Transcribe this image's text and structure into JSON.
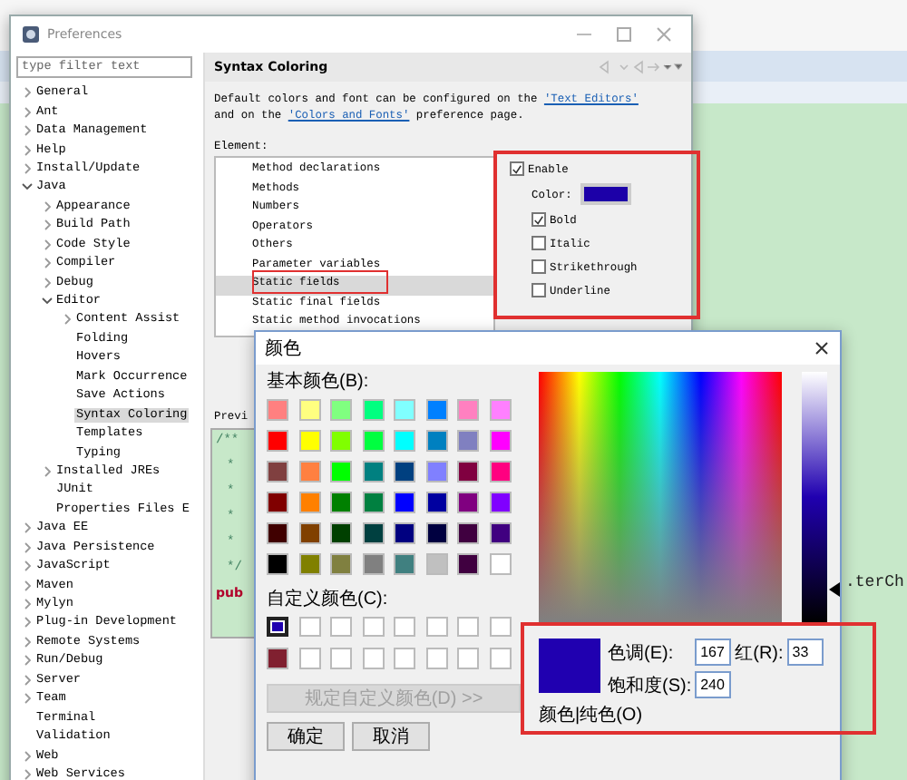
{
  "editor": {
    "fragment": ".terCh"
  },
  "preferences": {
    "title": "Preferences",
    "filter": {
      "placeholder": "type filter text"
    },
    "tree": [
      {
        "label": "General",
        "expanded": false,
        "selected": false
      },
      {
        "label": "Ant",
        "expanded": false,
        "selected": false
      },
      {
        "label": "Data Management",
        "expanded": false,
        "selected": false
      },
      {
        "label": "Help",
        "expanded": false,
        "selected": false
      },
      {
        "label": "Install/Update",
        "expanded": false,
        "selected": false
      },
      {
        "label": "Java",
        "expanded": true,
        "selected": false,
        "children": [
          {
            "label": "Appearance",
            "expanded": false,
            "selected": false
          },
          {
            "label": "Build Path",
            "expanded": false,
            "selected": false
          },
          {
            "label": "Code Style",
            "expanded": false,
            "selected": false
          },
          {
            "label": "Compiler",
            "expanded": false,
            "selected": false
          },
          {
            "label": "Debug",
            "expanded": false,
            "selected": false
          },
          {
            "label": "Editor",
            "expanded": true,
            "selected": false,
            "children": [
              {
                "label": "Content Assist",
                "expanded": false,
                "selected": false
              },
              {
                "label": "Folding",
                "selected": false
              },
              {
                "label": "Hovers",
                "selected": false
              },
              {
                "label": "Mark Occurrence",
                "selected": false
              },
              {
                "label": "Save Actions",
                "selected": false
              },
              {
                "label": "Syntax Coloring",
                "selected": true
              },
              {
                "label": "Templates",
                "selected": false
              },
              {
                "label": "Typing",
                "selected": false
              }
            ]
          },
          {
            "label": "Installed JREs",
            "expanded": false,
            "selected": false
          },
          {
            "label": "JUnit",
            "selected": false
          },
          {
            "label": "Properties Files E",
            "selected": false
          }
        ]
      },
      {
        "label": "Java EE",
        "expanded": false,
        "selected": false
      },
      {
        "label": "Java Persistence",
        "expanded": false,
        "selected": false
      },
      {
        "label": "JavaScript",
        "expanded": false,
        "selected": false
      },
      {
        "label": "Maven",
        "expanded": false,
        "selected": false
      },
      {
        "label": "Mylyn",
        "expanded": false,
        "selected": false
      },
      {
        "label": "Plug-in Development",
        "expanded": false,
        "selected": false
      },
      {
        "label": "Remote Systems",
        "expanded": false,
        "selected": false
      },
      {
        "label": "Run/Debug",
        "expanded": false,
        "selected": false
      },
      {
        "label": "Server",
        "expanded": false,
        "selected": false
      },
      {
        "label": "Team",
        "expanded": false,
        "selected": false
      },
      {
        "label": "Terminal",
        "selected": false
      },
      {
        "label": "Validation",
        "selected": false
      },
      {
        "label": "Web",
        "expanded": false,
        "selected": false
      },
      {
        "label": "Web Services",
        "expanded": false,
        "selected": false
      }
    ],
    "page": {
      "title": "Syntax Coloring",
      "description": [
        [
          {
            "text": "Default colors and font can be configured on the "
          },
          {
            "text": "'Text Editors'",
            "link": true
          }
        ],
        [
          {
            "text": "and on the "
          },
          {
            "text": "'Colors and Fonts'",
            "link": true
          },
          {
            "text": " preference page."
          }
        ]
      ],
      "element_label": "Element:",
      "elements": [
        {
          "label": "Method declarations",
          "selected": false
        },
        {
          "label": "Methods",
          "selected": false
        },
        {
          "label": "Numbers",
          "selected": false
        },
        {
          "label": "Operators",
          "selected": false
        },
        {
          "label": "Others",
          "selected": false
        },
        {
          "label": "Parameter variables",
          "selected": false
        },
        {
          "label": "Static fields",
          "selected": true
        },
        {
          "label": "Static final fields",
          "selected": false
        },
        {
          "label": "Static method invocations",
          "selected": false
        }
      ],
      "options": {
        "enable": {
          "label": "Enable",
          "checked": true
        },
        "color_label": "Color:",
        "color": "#1c00a8",
        "styles": [
          {
            "label": "Bold",
            "checked": true
          },
          {
            "label": "Italic",
            "checked": false
          },
          {
            "label": "Strikethrough",
            "checked": false
          },
          {
            "label": "Underline",
            "checked": false
          }
        ]
      },
      "preview_label": "Previ",
      "preview_lines": [
        {
          "text": "/**",
          "kind": "comment"
        },
        {
          "text": "*",
          "kind": "comment"
        },
        {
          "text": "*",
          "kind": "comment"
        },
        {
          "text": "*",
          "kind": "comment"
        },
        {
          "text": "*",
          "kind": "comment"
        },
        {
          "text": "*/",
          "kind": "comment"
        },
        {
          "text": "pub",
          "kind": "keyword"
        }
      ]
    }
  },
  "color_dialog": {
    "title": "颜色",
    "basic_label": "基本颜色(B):",
    "basic_colors": [
      {
        "color": "#ff8080"
      },
      {
        "color": "#ffff80"
      },
      {
        "color": "#80ff80"
      },
      {
        "color": "#00ff80"
      },
      {
        "color": "#80ffff"
      },
      {
        "color": "#0080ff"
      },
      {
        "color": "#ff80c0"
      },
      {
        "color": "#ff80ff"
      },
      {
        "color": "#ff0000"
      },
      {
        "color": "#ffff00"
      },
      {
        "color": "#80ff00"
      },
      {
        "color": "#00ff40"
      },
      {
        "color": "#00ffff"
      },
      {
        "color": "#0080c0"
      },
      {
        "color": "#8080c0"
      },
      {
        "color": "#ff00ff"
      },
      {
        "color": "#804040"
      },
      {
        "color": "#ff8040"
      },
      {
        "color": "#00ff00"
      },
      {
        "color": "#008080"
      },
      {
        "color": "#004080"
      },
      {
        "color": "#8080ff"
      },
      {
        "color": "#800040"
      },
      {
        "color": "#ff0080"
      },
      {
        "color": "#800000"
      },
      {
        "color": "#ff8000"
      },
      {
        "color": "#008000"
      },
      {
        "color": "#008040"
      },
      {
        "color": "#0000ff"
      },
      {
        "color": "#0000a0"
      },
      {
        "color": "#800080"
      },
      {
        "color": "#8000ff"
      },
      {
        "color": "#400000"
      },
      {
        "color": "#804000"
      },
      {
        "color": "#004000"
      },
      {
        "color": "#004040"
      },
      {
        "color": "#000080"
      },
      {
        "color": "#000040"
      },
      {
        "color": "#400040"
      },
      {
        "color": "#400080"
      },
      {
        "color": "#000000"
      },
      {
        "color": "#808000"
      },
      {
        "color": "#808040"
      },
      {
        "color": "#808080"
      },
      {
        "color": "#408080"
      },
      {
        "color": "#c0c0c0"
      },
      {
        "color": "#400040"
      },
      {
        "color": "#ffffff"
      }
    ],
    "custom_label": "自定义颜色(C):",
    "custom_colors": [
      {
        "color": "#2000b0",
        "selected": true
      },
      {
        "color": "#ffffff",
        "selected": false
      },
      {
        "color": "#ffffff",
        "selected": false
      },
      {
        "color": "#ffffff",
        "selected": false
      },
      {
        "color": "#ffffff",
        "selected": false
      },
      {
        "color": "#ffffff",
        "selected": false
      },
      {
        "color": "#ffffff",
        "selected": false
      },
      {
        "color": "#ffffff",
        "selected": false
      },
      {
        "color": "#802030",
        "selected": false
      },
      {
        "color": "#ffffff",
        "selected": false
      },
      {
        "color": "#ffffff",
        "selected": false
      },
      {
        "color": "#ffffff",
        "selected": false
      },
      {
        "color": "#ffffff",
        "selected": false
      },
      {
        "color": "#ffffff",
        "selected": false
      },
      {
        "color": "#ffffff",
        "selected": false
      },
      {
        "color": "#ffffff",
        "selected": false
      }
    ],
    "define_button": {
      "label": "规定自定义颜色(D) >>",
      "disabled": true
    },
    "ok_button": "确定",
    "cancel_button": "取消",
    "luminance": {
      "level": 0.13
    },
    "preview_label": "颜色|纯色(O)",
    "fields": [
      {
        "label": "色调(E):",
        "value": "167"
      },
      {
        "label": "红(R):",
        "value": "33"
      },
      {
        "label": "饱和度(S):",
        "value": "240"
      }
    ]
  }
}
